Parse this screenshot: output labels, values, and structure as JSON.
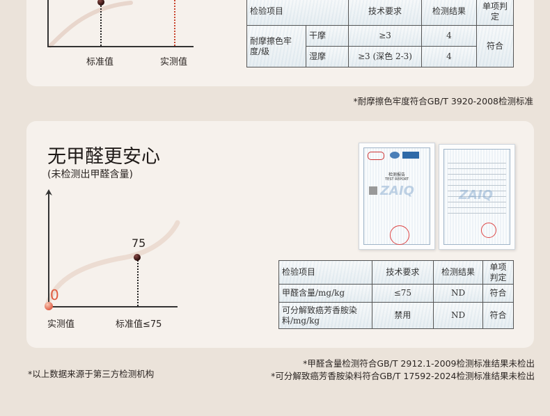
{
  "top": {
    "chart": {
      "labels": [
        "标准值",
        "实测值"
      ]
    },
    "table": {
      "headers": [
        "检验项目",
        "技术要求",
        "检测结果",
        "单项判定"
      ],
      "item": "耐摩擦色牢度/级",
      "rows": [
        {
          "sub": "干摩",
          "req": "≥3",
          "result": "4"
        },
        {
          "sub": "湿摩",
          "req": "≥3 (深色  2-3)",
          "result": "4"
        }
      ],
      "verdict": "符合"
    },
    "note": "*耐摩擦色牢度符合GB/T 3920-2008检测标准"
  },
  "bottom": {
    "title": "无甲醛更安心",
    "subtitle": "(未检测出甲醛含量)",
    "chart_data": {
      "type": "bar",
      "categories": [
        "实测值",
        "标准值≤75"
      ],
      "values": [
        0,
        75
      ],
      "value_labels": [
        "0",
        "75"
      ],
      "colors": {
        "measured": "#e05a3f",
        "standard": "#2a0d0b"
      }
    },
    "table": {
      "headers": [
        "检验项目",
        "技术要求",
        "检测结果",
        "单项判定"
      ],
      "rows": [
        {
          "item": "甲醛含量/mg/kg",
          "req": "≤75",
          "result": "ND",
          "verdict": "符合"
        },
        {
          "item": "可分解致癌芳香胺染料/mg/kg",
          "req": "禁用",
          "result": "ND",
          "verdict": "符合"
        }
      ]
    },
    "report": {
      "cover_title": "检测报告",
      "cover_subtitle": "TEST REPORT",
      "watermark": "ZAIQ"
    },
    "notes": [
      "*甲醛含量检测符合GB/T 2912.1-2009检测标准结果未检出",
      "*可分解致癌芳香胺染料符合GB/T 17592-2024检测标准结果未检出"
    ]
  },
  "footnote": "*以上数据来源于第三方检测机构",
  "colors": {
    "background": "#ebe3da",
    "card": "#f6f1ec",
    "accent_red": "#e05a3f"
  }
}
